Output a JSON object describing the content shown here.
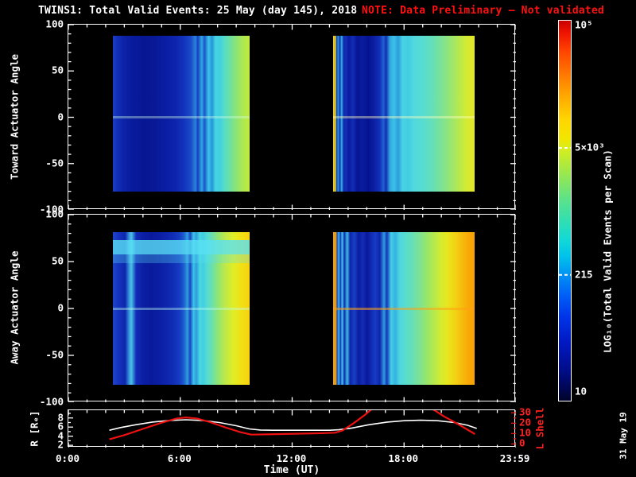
{
  "ui": {
    "title": "TWINS1: Total Valid Events: 25 May (day 145), 2018",
    "note": "NOTE: Data Preliminary – Not validated",
    "watermark": "31 May 19"
  },
  "colors": {
    "background": "#000000",
    "foreground": "#ffffff",
    "note_red": "#ff1111",
    "lshell_red": "#ee1111",
    "r_curve_white": "#ffffff"
  },
  "chart_data": {
    "type": "heatmap",
    "xaxis": {
      "title": "Time (UT)",
      "range": [
        0,
        24
      ],
      "minor_step": 1,
      "major_step": 6,
      "ticks": [
        {
          "h": 0,
          "label": "0:00"
        },
        {
          "h": 6,
          "label": "6:00"
        },
        {
          "h": 12,
          "label": "12:00"
        },
        {
          "h": 18,
          "label": "18:00"
        },
        {
          "h": 23.983,
          "label": "23:59"
        }
      ]
    },
    "heatmaps": [
      {
        "id": "toward",
        "ylabel": "Toward Actuator Angle",
        "y_axis": {
          "min": -100,
          "max": 100,
          "minor_step": 10,
          "major_step": 50,
          "major_ticks": [
            {
              "v": 100,
              "label": "100"
            },
            {
              "v": 50,
              "label": "50"
            },
            {
              "v": 0,
              "label": "0"
            },
            {
              "v": -50,
              "label": "-50"
            },
            {
              "v": -100,
              "label": "-100"
            }
          ]
        },
        "angle_extent": [
          88,
          -80
        ],
        "segments": [
          {
            "t_start": 2.4,
            "t_end": 9.7,
            "center_line": {
              "color": "rgba(210,255,230,0.38)"
            },
            "stops": [
              [
                0,
                "#1b3ec8"
              ],
              [
                3,
                "#1230b8"
              ],
              [
                8,
                "#0c22a8"
              ],
              [
                15,
                "#081a9c"
              ],
              [
                22,
                "#071794"
              ],
              [
                30,
                "#081896"
              ],
              [
                38,
                "#0a1da2"
              ],
              [
                46,
                "#0d24ae"
              ],
              [
                52,
                "#1233bc"
              ],
              [
                57,
                "#1a49c8"
              ],
              [
                60.5,
                "#2a83d8"
              ],
              [
                62,
                "#153cc2"
              ],
              [
                65,
                "#2fa9e2"
              ],
              [
                67,
                "#1a55cc"
              ],
              [
                70,
                "#3cc6e8"
              ],
              [
                72.5,
                "#2593da"
              ],
              [
                75,
                "#46d4e2"
              ],
              [
                78,
                "#3fcfe0"
              ],
              [
                81,
                "#52dbce"
              ],
              [
                85,
                "#68dfa8"
              ],
              [
                90,
                "#8ce476"
              ],
              [
                95,
                "#abe854"
              ],
              [
                100,
                "#c3ea3e"
              ]
            ]
          },
          {
            "t_start": 14.2,
            "t_end": 21.8,
            "center_line": {
              "color": "rgba(255,255,190,0.42)"
            },
            "stops": [
              [
                0,
                "#d8e020"
              ],
              [
                1,
                "#f0b010"
              ],
              [
                1.8,
                "#c8d81a"
              ],
              [
                2.4,
                "#1634c0"
              ],
              [
                3.6,
                "#2a96da"
              ],
              [
                4.8,
                "#122cb8"
              ],
              [
                6,
                "#34b4e2"
              ],
              [
                7.5,
                "#0f24ac"
              ],
              [
                9,
                "#1231ba"
              ],
              [
                11,
                "#0a1a9e"
              ],
              [
                14,
                "#112eb6"
              ],
              [
                17,
                "#081594"
              ],
              [
                21,
                "#0a1c9e"
              ],
              [
                25,
                "#071292"
              ],
              [
                29,
                "#0c1fa4"
              ],
              [
                33,
                "#1130b8"
              ],
              [
                35.5,
                "#1e64d0"
              ],
              [
                37.5,
                "#122eb6"
              ],
              [
                40,
                "#2fa5de"
              ],
              [
                43,
                "#3cc2e6"
              ],
              [
                46,
                "#2b9cdc"
              ],
              [
                49,
                "#48d2e4"
              ],
              [
                53,
                "#42cde2"
              ],
              [
                57,
                "#50d8de"
              ],
              [
                62,
                "#55dcd4"
              ],
              [
                68,
                "#5fdec2"
              ],
              [
                74,
                "#71e1a4"
              ],
              [
                81,
                "#8fe57c"
              ],
              [
                88,
                "#b2e854"
              ],
              [
                94,
                "#d2eb34"
              ],
              [
                100,
                "#e6e622"
              ]
            ]
          }
        ]
      },
      {
        "id": "away",
        "ylabel": "Away Actuator Angle",
        "y_axis": {
          "min": -100,
          "max": 100,
          "minor_step": 10,
          "major_step": 50,
          "major_ticks": [
            {
              "v": 100,
              "label": "100"
            },
            {
              "v": 50,
              "label": "50"
            },
            {
              "v": 0,
              "label": "0"
            },
            {
              "v": -50,
              "label": "-50"
            },
            {
              "v": -100,
              "label": "-100"
            }
          ]
        },
        "angle_extent": [
          81,
          -81
        ],
        "segments": [
          {
            "t_start": 2.4,
            "t_end": 9.7,
            "center_line": {
              "color": "rgba(190,255,240,0.40)"
            },
            "bands": [
              {
                "a0": 73,
                "a1": 58,
                "color": "rgba(90,225,245,0.80)"
              },
              {
                "a0": 58,
                "a1": 48,
                "color": "rgba(90,225,245,0.30)"
              }
            ],
            "stops": [
              [
                0,
                "#1d44cc"
              ],
              [
                4,
                "#1534be"
              ],
              [
                9,
                "#0e26ae"
              ],
              [
                12,
                "#3a9ade"
              ],
              [
                13.5,
                "#4cc2e4"
              ],
              [
                15,
                "#2f84d6"
              ],
              [
                17,
                "#112cb6"
              ],
              [
                22,
                "#0b1ea4"
              ],
              [
                28,
                "#091a9c"
              ],
              [
                34,
                "#0b1ea4"
              ],
              [
                40,
                "#0e26ae"
              ],
              [
                45,
                "#1130b8"
              ],
              [
                49,
                "#163ec4"
              ],
              [
                52,
                "#1d5ed0"
              ],
              [
                54.5,
                "#2f9fdc"
              ],
              [
                56.5,
                "#1a44c8"
              ],
              [
                59,
                "#3cc6e8"
              ],
              [
                61,
                "#2d9ada"
              ],
              [
                63.5,
                "#4ad6e4"
              ],
              [
                66,
                "#40cfe0"
              ],
              [
                69,
                "#55dcd2"
              ],
              [
                73,
                "#6ee0a8"
              ],
              [
                77,
                "#92e570"
              ],
              [
                82,
                "#bce94a"
              ],
              [
                88,
                "#dfee26"
              ],
              [
                94,
                "#f2e015"
              ],
              [
                100,
                "#f6d210"
              ]
            ]
          },
          {
            "t_start": 14.2,
            "t_end": 21.8,
            "center_line": {
              "color": "rgba(255,160,20,0.55)"
            },
            "stops": [
              [
                0,
                "#e0a81a"
              ],
              [
                1,
                "#f29c08"
              ],
              [
                2,
                "#ef9d06"
              ],
              [
                2.8,
                "#1a46ca"
              ],
              [
                4,
                "#38bce4"
              ],
              [
                5.2,
                "#1330ba"
              ],
              [
                6.4,
                "#42cbe6"
              ],
              [
                8,
                "#112ab4"
              ],
              [
                10,
                "#3cc0e4"
              ],
              [
                12,
                "#0e22aa"
              ],
              [
                15,
                "#1742c6"
              ],
              [
                18,
                "#0c1ca0"
              ],
              [
                21,
                "#122eb6"
              ],
              [
                24,
                "#0a189a"
              ],
              [
                27,
                "#112cb4"
              ],
              [
                30,
                "#163cc2"
              ],
              [
                33,
                "#0e24ac"
              ],
              [
                36,
                "#2f9cdc"
              ],
              [
                38,
                "#1334bc"
              ],
              [
                41,
                "#44cfe6"
              ],
              [
                44,
                "#34b2e0"
              ],
              [
                47,
                "#4ed6e0"
              ],
              [
                51,
                "#57dcd0"
              ],
              [
                56,
                "#66dfb6"
              ],
              [
                61,
                "#7ce294"
              ],
              [
                66,
                "#97e66c"
              ],
              [
                71,
                "#b4e94e"
              ],
              [
                76,
                "#d2ec32"
              ],
              [
                81,
                "#e8e61e"
              ],
              [
                86,
                "#f2d414"
              ],
              [
                91,
                "#f6bc0c"
              ],
              [
                96,
                "#f8a806"
              ],
              [
                100,
                "#f8a004"
              ]
            ]
          }
        ]
      }
    ],
    "ephemeris": {
      "left_axis": {
        "label": "R [Rₑ]",
        "range": [
          1.5,
          9.7
        ],
        "minor_step": 1,
        "minor_start": 2,
        "minor_end": 9,
        "major_ticks": [
          {
            "v": 8,
            "label": "8"
          },
          {
            "v": 6,
            "label": "6"
          },
          {
            "v": 4,
            "label": "4"
          },
          {
            "v": 2,
            "label": "2"
          }
        ]
      },
      "right_axis": {
        "label": "L Shell",
        "range": [
          -3.5,
          32.5
        ],
        "minor_step": 5,
        "minor_start": 0,
        "minor_end": 30,
        "major_ticks": [
          {
            "v": 30,
            "label": "30"
          },
          {
            "v": 20,
            "label": "20"
          },
          {
            "v": 10,
            "label": "10"
          },
          {
            "v": 0,
            "label": "0"
          }
        ]
      },
      "series": [
        {
          "name": "R",
          "axis": "left",
          "color": "#ffffff",
          "width": 1.6,
          "branches": [
            [
              [
                2.2,
                5.3
              ],
              [
                2.8,
                5.9
              ],
              [
                3.6,
                6.5
              ],
              [
                4.5,
                7.1
              ],
              [
                5.4,
                7.45
              ],
              [
                6.3,
                7.6
              ],
              [
                7.2,
                7.45
              ],
              [
                8.1,
                7.0
              ],
              [
                9.0,
                6.3
              ],
              [
                9.7,
                5.6
              ],
              [
                10.3,
                5.35
              ],
              [
                11,
                5.3
              ],
              [
                12,
                5.3
              ],
              [
                13,
                5.3
              ],
              [
                14,
                5.3
              ],
              [
                14.5,
                5.4
              ],
              [
                15.2,
                5.8
              ],
              [
                16.1,
                6.5
              ],
              [
                17.1,
                7.1
              ],
              [
                18.0,
                7.4
              ],
              [
                18.9,
                7.5
              ],
              [
                19.8,
                7.4
              ],
              [
                20.7,
                7.0
              ],
              [
                21.4,
                6.4
              ],
              [
                21.9,
                5.7
              ]
            ]
          ]
        },
        {
          "name": "L Shell",
          "axis": "right",
          "color": "#ee1111",
          "width": 2.2,
          "branches": [
            [
              [
                2.2,
                4.5
              ],
              [
                3.0,
                8.5
              ],
              [
                4.0,
                14.5
              ],
              [
                5.0,
                20.5
              ],
              [
                5.8,
                24.5
              ],
              [
                6.3,
                25.5
              ],
              [
                6.9,
                24.5
              ],
              [
                7.6,
                21
              ],
              [
                8.4,
                16
              ],
              [
                9.2,
                11.5
              ],
              [
                9.8,
                9
              ],
              [
                10.6,
                9.2
              ],
              [
                11.6,
                9.6
              ],
              [
                12.6,
                10
              ],
              [
                13.6,
                10.4
              ],
              [
                14.3,
                10.8
              ],
              [
                14.7,
                13
              ],
              [
                15.3,
                20
              ],
              [
                15.9,
                28
              ],
              [
                16.3,
                34
              ]
            ],
            [
              [
                19.5,
                34
              ],
              [
                20.1,
                27
              ],
              [
                20.9,
                19
              ],
              [
                21.8,
                9.5
              ]
            ]
          ]
        }
      ]
    },
    "colorbar": {
      "title": "LOG₁₀(Total Valid Events per Scan)",
      "ticks": [
        {
          "frac": 0.012,
          "label": "10⁵",
          "dashed": false
        },
        {
          "frac": 0.335,
          "label": "5×10³",
          "dashed": true
        },
        {
          "frac": 0.669,
          "label": "215",
          "dashed": true
        },
        {
          "frac": 0.978,
          "label": "10",
          "dashed": false
        }
      ],
      "stops": [
        [
          0,
          "#c80000"
        ],
        [
          0.03,
          "#ee1100"
        ],
        [
          0.08,
          "#ff4400"
        ],
        [
          0.14,
          "#ff7700"
        ],
        [
          0.2,
          "#ffaa00"
        ],
        [
          0.26,
          "#ffd500"
        ],
        [
          0.31,
          "#f2e600"
        ],
        [
          0.335,
          "#d8ee1c"
        ],
        [
          0.4,
          "#9ce84c"
        ],
        [
          0.47,
          "#5ce288"
        ],
        [
          0.53,
          "#2edfb4"
        ],
        [
          0.58,
          "#10d8d8"
        ],
        [
          0.62,
          "#00c2ea"
        ],
        [
          0.665,
          "#0096f4"
        ],
        [
          0.72,
          "#0060f8"
        ],
        [
          0.78,
          "#0034e8"
        ],
        [
          0.85,
          "#0018c0"
        ],
        [
          0.92,
          "#000d8a"
        ],
        [
          0.97,
          "#000650"
        ],
        [
          1,
          "#000428"
        ]
      ]
    }
  }
}
